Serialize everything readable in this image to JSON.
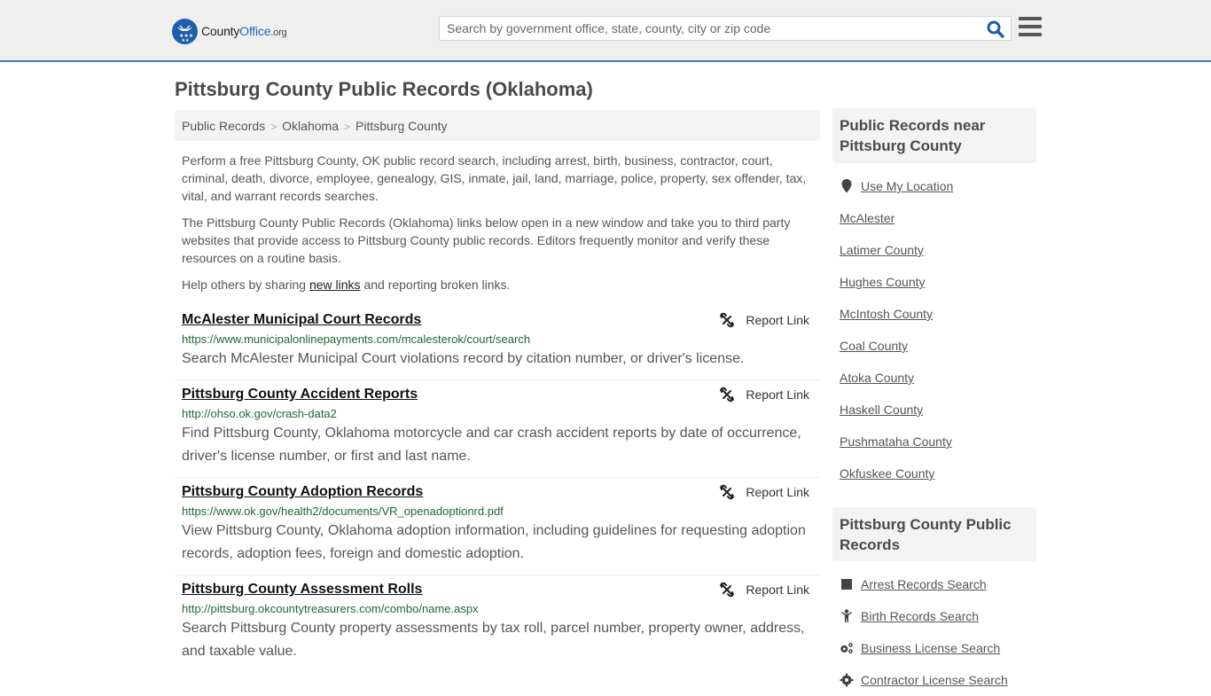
{
  "header": {
    "logo": {
      "name_part1": "County",
      "name_part2": "Office",
      "name_part3": ".org"
    },
    "search": {
      "placeholder": "Search by government office, state, county, city or zip code",
      "value": ""
    },
    "colors": {
      "brand_blue": "#1d5fa8",
      "header_bg": "#efefef",
      "header_border": "#3a7ab0"
    }
  },
  "page": {
    "title": "Pittsburg County Public Records (Oklahoma)",
    "breadcrumb": [
      {
        "label": "Public Records"
      },
      {
        "label": "Oklahoma"
      },
      {
        "label": "Pittsburg County"
      }
    ],
    "breadcrumb_separator": ">",
    "intro": {
      "p1": "Perform a free Pittsburg County, OK public record search, including arrest, birth, business, contractor, court, criminal, death, divorce, employee, genealogy, GIS, inmate, jail, land, marriage, police, property, sex offender, tax, vital, and warrant records searches.",
      "p2": "The Pittsburg County Public Records (Oklahoma) links below open in a new window and take you to third party websites that provide access to Pittsburg County public records. Editors frequently monitor and verify these resources on a routine basis.",
      "p3_before": "Help others by sharing ",
      "p3_link": "new links",
      "p3_after": " and reporting broken links."
    }
  },
  "records": [
    {
      "title": "McAlester Municipal Court Records",
      "url": "https://www.municipalonlinepayments.com/mcalesterok/court/search",
      "description": "Search McAlester Municipal Court violations record by citation number, or driver's license.",
      "report_label": "Report Link"
    },
    {
      "title": "Pittsburg County Accident Reports",
      "url": "http://ohso.ok.gov/crash-data2",
      "description": "Find Pittsburg County, Oklahoma motorcycle and car crash accident reports by date of occurrence, driver's license number, or first and last name.",
      "report_label": "Report Link"
    },
    {
      "title": "Pittsburg County Adoption Records",
      "url": "https://www.ok.gov/health2/documents/VR_openadoptionrd.pdf",
      "description": "View Pittsburg County, Oklahoma adoption information, including guidelines for requesting adoption records, adoption fees, foreign and domestic adoption.",
      "report_label": "Report Link"
    },
    {
      "title": "Pittsburg County Assessment Rolls",
      "url": "http://pittsburg.okcountytreasurers.com/combo/name.aspx",
      "description": "Search Pittsburg County property assessments by tax roll, parcel number, property owner, address, and taxable value.",
      "report_label": "Report Link"
    }
  ],
  "sidebar": {
    "nearby": {
      "heading": "Public Records near Pittsburg County",
      "use_location": "Use My Location",
      "items": [
        "McAlester",
        "Latimer County",
        "Hughes County",
        "McIntosh County",
        "Coal County",
        "Atoka County",
        "Haskell County",
        "Pushmataha County",
        "Okfuskee County"
      ]
    },
    "county_records": {
      "heading": "Pittsburg County Public Records",
      "items": [
        {
          "label": "Arrest Records Search",
          "icon": "square-icon"
        },
        {
          "label": "Birth Records Search",
          "icon": "child-icon"
        },
        {
          "label": "Business License Search",
          "icon": "gears-icon"
        },
        {
          "label": "Contractor License Search",
          "icon": "gear-icon"
        }
      ]
    }
  }
}
